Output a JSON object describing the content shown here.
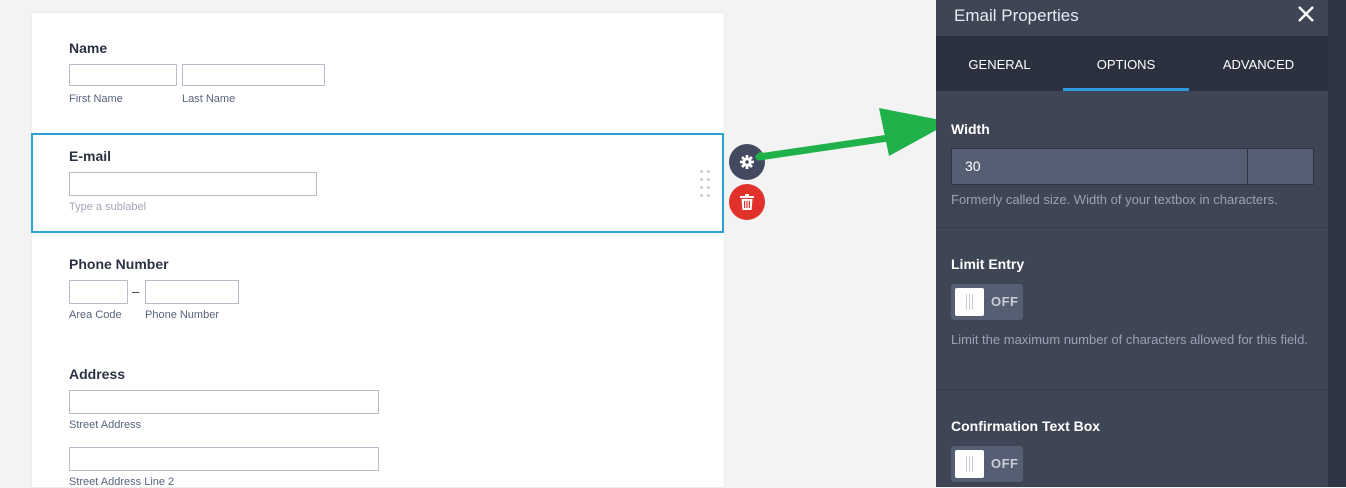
{
  "form": {
    "name": {
      "label": "Name",
      "first_sublabel": "First Name",
      "last_sublabel": "Last Name"
    },
    "email": {
      "label": "E-mail",
      "sublabel_placeholder": "Type a sublabel"
    },
    "phone": {
      "label": "Phone Number",
      "separator": "–",
      "area_sublabel": "Area Code",
      "number_sublabel": "Phone Number"
    },
    "address": {
      "label": "Address",
      "street_sublabel": "Street Address",
      "street2_sublabel": "Street Address Line 2"
    }
  },
  "field_actions": {
    "settings_icon": "gear-icon",
    "delete_icon": "trash-icon",
    "arrow_color": "#20b14a"
  },
  "panel": {
    "title": "Email Properties",
    "close_icon": "close-icon",
    "tabs": [
      {
        "label": "GENERAL",
        "active": false
      },
      {
        "label": "OPTIONS",
        "active": true
      },
      {
        "label": "ADVANCED",
        "active": false
      }
    ],
    "width": {
      "label": "Width",
      "value": "30",
      "description": "Formerly called size. Width of your textbox in characters."
    },
    "limit_entry": {
      "label": "Limit Entry",
      "state": "OFF",
      "description": "Limit the maximum number of characters allowed for this field."
    },
    "confirmation": {
      "label": "Confirmation Text Box",
      "state": "OFF"
    }
  },
  "colors": {
    "accent": "#2aa2d6",
    "tab_underline": "#2d9ae0",
    "delete": "#e0312a",
    "panel_bg": "#3e4555"
  }
}
